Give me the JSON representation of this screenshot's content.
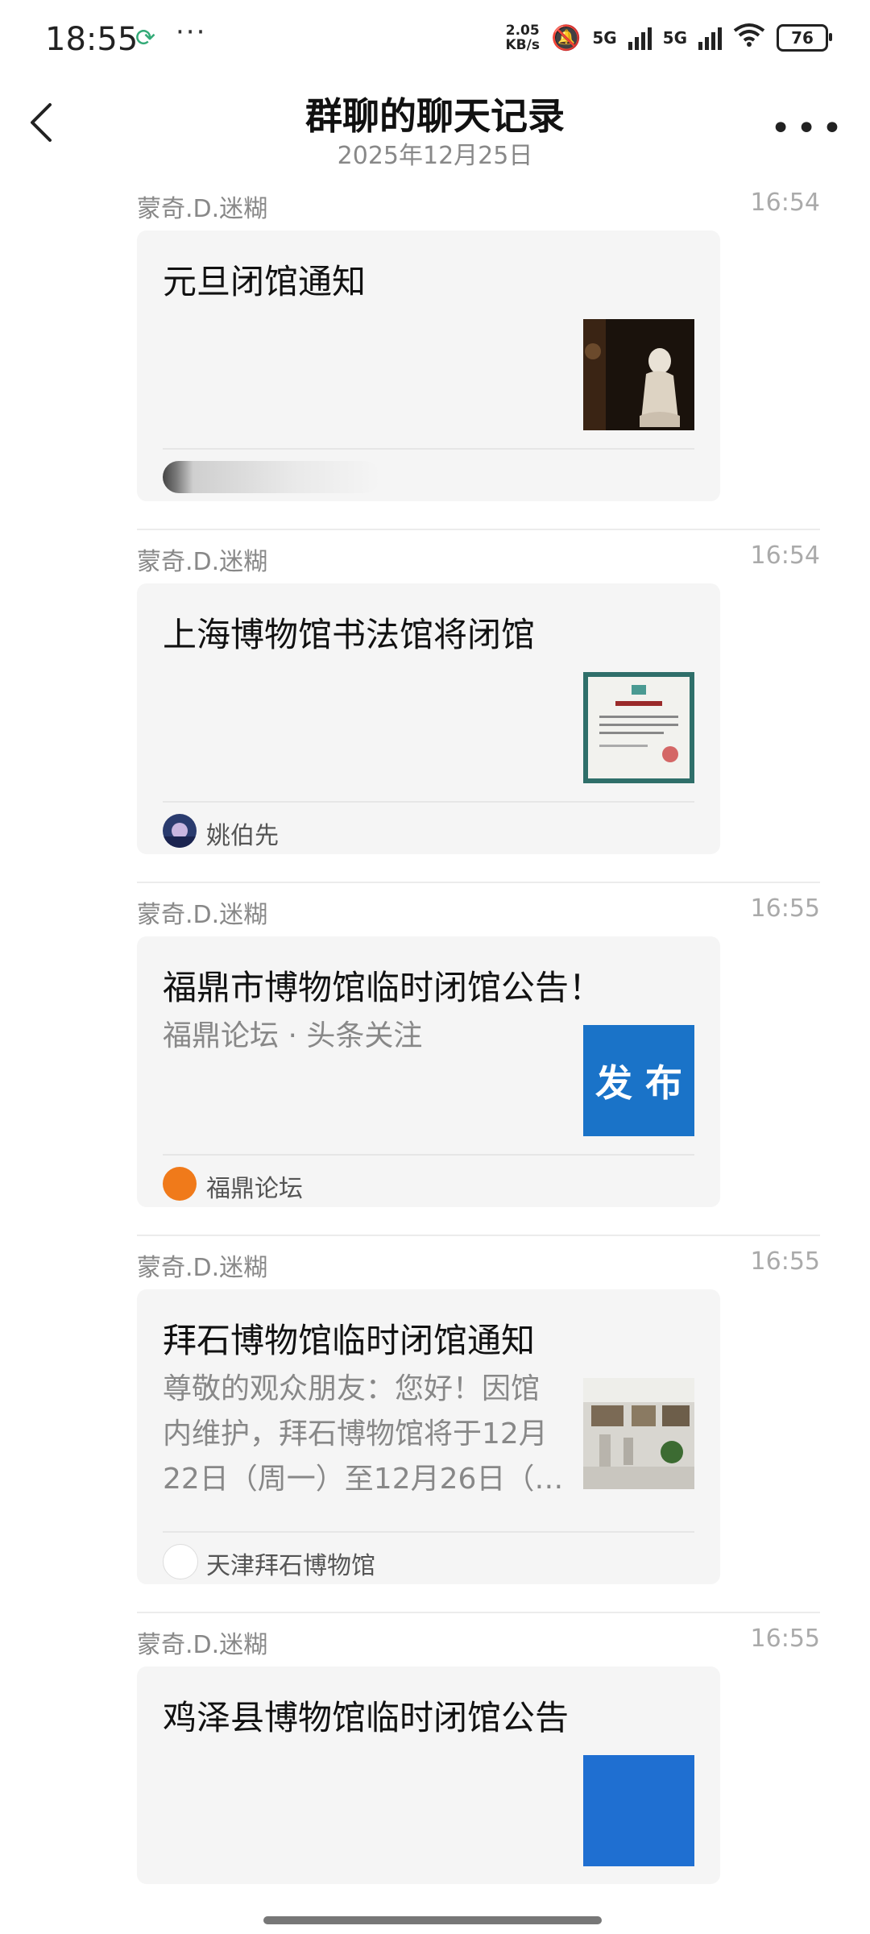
{
  "status_bar": {
    "time": "18:55",
    "speed_top": "2.05",
    "speed_bottom": "KB/s",
    "signal1_label": "5G",
    "signal2_label": "5G",
    "battery": "76"
  },
  "header": {
    "title": "群聊的聊天记录",
    "date": "2025年12月25日"
  },
  "messages": [
    {
      "sender": "蒙奇.D.迷糊",
      "time": "16:54",
      "title": "元旦闭馆通知",
      "desc": "",
      "source": ""
    },
    {
      "sender": "蒙奇.D.迷糊",
      "time": "16:54",
      "title": "上海博物馆书法馆将闭馆",
      "desc": "",
      "source": "姚伯先"
    },
    {
      "sender": "蒙奇.D.迷糊",
      "time": "16:55",
      "title": "福鼎市博物馆临时闭馆公告！",
      "desc": "福鼎论坛 · 头条关注",
      "source": "福鼎论坛",
      "thumb_text": "发 布"
    },
    {
      "sender": "蒙奇.D.迷糊",
      "time": "16:55",
      "title": "拜石博物馆临时闭馆通知",
      "desc": "尊敬的观众朋友：您好！因馆内维护，拜石博物馆将于12月22日（周一）至12月26日（…",
      "source": "天津拜石博物馆"
    },
    {
      "sender": "蒙奇.D.迷糊",
      "time": "16:55",
      "title": "鸡泽县博物馆临时闭馆公告",
      "desc": "",
      "source": ""
    }
  ]
}
